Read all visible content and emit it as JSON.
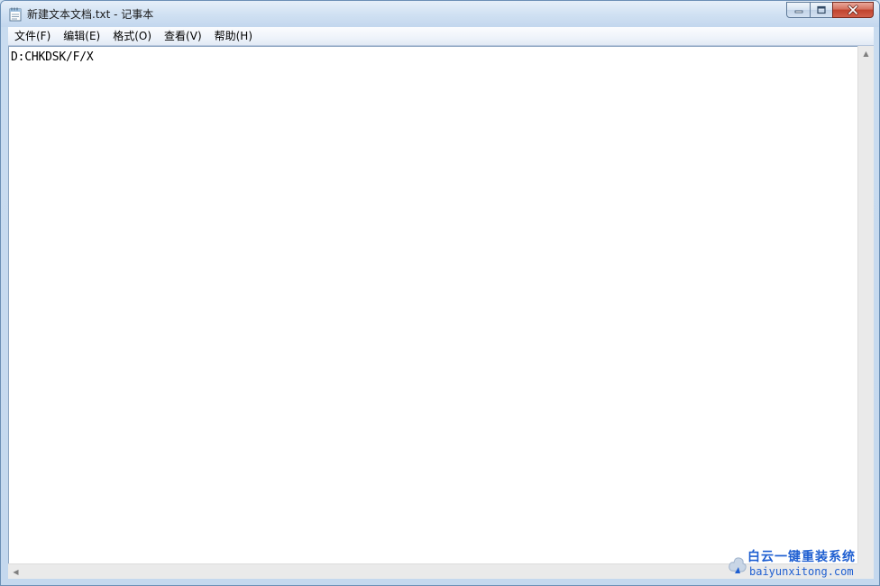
{
  "window": {
    "title": "新建文本文档.txt - 记事本"
  },
  "menu": {
    "items": [
      {
        "label": "文件(F)"
      },
      {
        "label": "编辑(E)"
      },
      {
        "label": "格式(O)"
      },
      {
        "label": "查看(V)"
      },
      {
        "label": "帮助(H)"
      }
    ]
  },
  "editor": {
    "content": "D:CHKDSK/F/X"
  },
  "watermark": {
    "title": "白云一键重装系统",
    "url": "baiyunxitong.com"
  },
  "icons": {
    "app": "notepad-icon",
    "minimize": "minimize-icon",
    "maximize": "maximize-icon",
    "close": "close-icon"
  },
  "colors": {
    "accent": "#1f5fd1",
    "close_button": "#c0432d"
  }
}
